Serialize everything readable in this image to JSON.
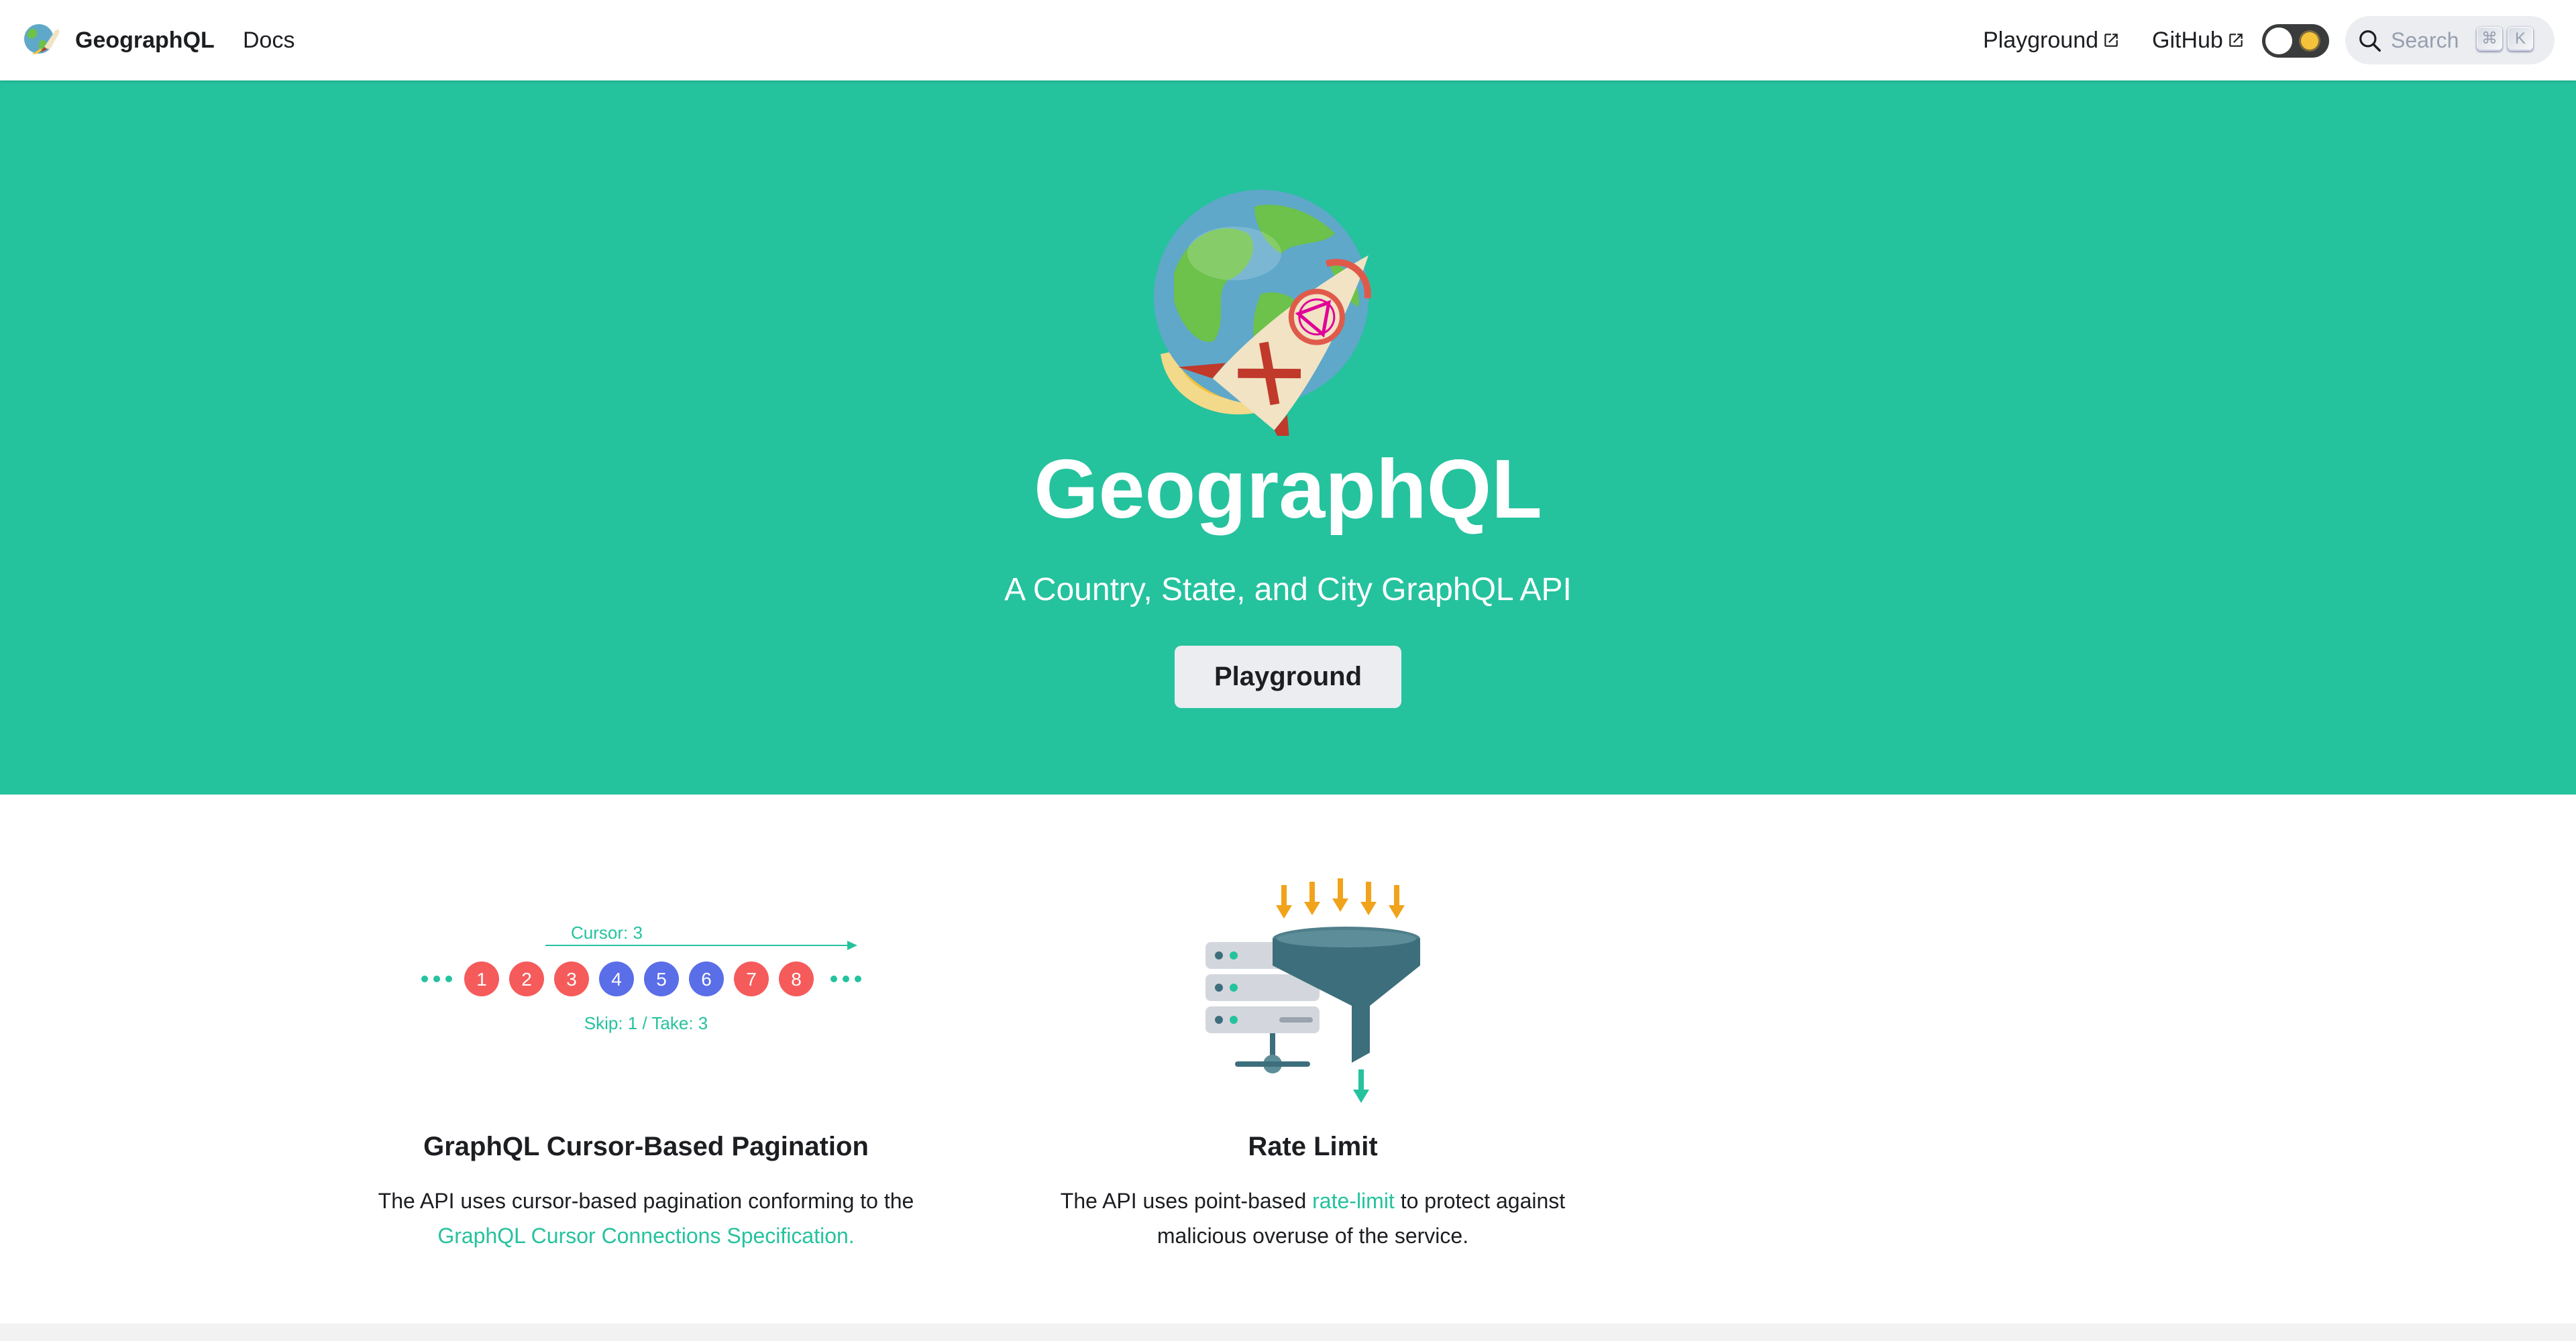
{
  "navbar": {
    "brand": "GeographQL",
    "docs_label": "Docs",
    "playground_label": "Playground",
    "github_label": "GitHub",
    "search_placeholder": "Search",
    "search_key_cmd": "⌘",
    "search_key_k": "K",
    "icons": [
      "logo-icon",
      "external-link-icon",
      "search-icon",
      "sun-icon"
    ]
  },
  "hero": {
    "title": "GeographQL",
    "subtitle": "A Country, State, and City GraphQL API",
    "button_label": "Playground"
  },
  "features": [
    {
      "title": "GraphQL Cursor-Based Pagination",
      "desc_text": "The API uses cursor-based pagination conforming to the",
      "desc_link": "GraphQL Cursor Connections Specification.",
      "graphic": {
        "cursor_label": "Cursor: 3",
        "skip_take_label": "Skip: 1 / Take: 3",
        "items": [
          "1",
          "2",
          "3",
          "4",
          "5",
          "6",
          "7",
          "8"
        ],
        "selected": [
          "4",
          "5",
          "6"
        ]
      }
    },
    {
      "title": "Rate Limit",
      "desc_before": "The API uses point-based",
      "desc_link": "rate-limit",
      "desc_after": "to protect against malicious overuse of the service."
    }
  ],
  "colors": {
    "accent": "#25c29e",
    "red_item": "#f55b5b",
    "blue_item": "#5a6ee8",
    "arrow_orange": "#f0a31b",
    "funnel": "#3d6e7c"
  }
}
